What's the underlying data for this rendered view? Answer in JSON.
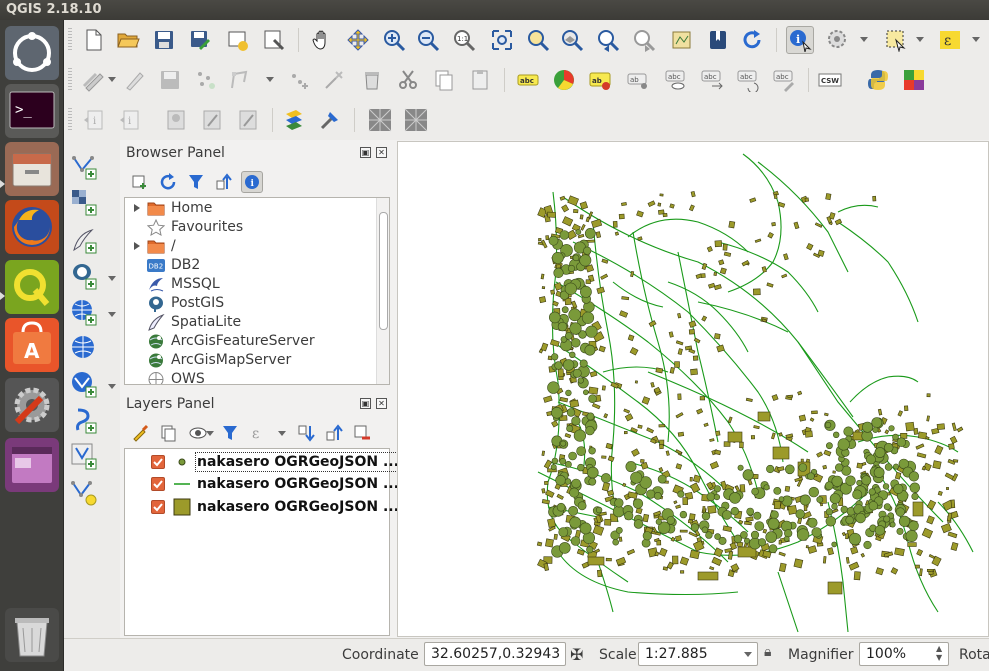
{
  "window": {
    "title": "QGIS 2.18.10"
  },
  "launcher": {
    "items": [
      "dash-home",
      "terminal",
      "files",
      "firefox",
      "qgis",
      "software-center",
      "system-settings",
      "workspace-switcher",
      "trash"
    ]
  },
  "browser_panel": {
    "title": "Browser Panel",
    "items": [
      {
        "label": "Home",
        "icon": "folder-icon",
        "expandable": true
      },
      {
        "label": "Favourites",
        "icon": "star-icon",
        "expandable": false
      },
      {
        "label": "/",
        "icon": "folder-icon",
        "expandable": true
      },
      {
        "label": "DB2",
        "icon": "db2-icon",
        "expandable": false
      },
      {
        "label": "MSSQL",
        "icon": "mssql-icon",
        "expandable": false
      },
      {
        "label": "PostGIS",
        "icon": "postgis-icon",
        "expandable": false
      },
      {
        "label": "SpatiaLite",
        "icon": "spatialite-icon",
        "expandable": false
      },
      {
        "label": "ArcGisFeatureServer",
        "icon": "arcgis-icon",
        "expandable": false
      },
      {
        "label": "ArcGisMapServer",
        "icon": "arcgis-icon",
        "expandable": false
      },
      {
        "label": "OWS",
        "icon": "globe-icon",
        "expandable": false
      }
    ]
  },
  "layers_panel": {
    "title": "Layers Panel",
    "layers": [
      {
        "name": "nakasero OGRGeoJSON ...",
        "geometry": "point",
        "checked": true
      },
      {
        "name": "nakasero OGRGeoJSON ...",
        "geometry": "line",
        "checked": true
      },
      {
        "name": "nakasero OGRGeoJSON ...",
        "geometry": "polygon",
        "checked": true
      }
    ]
  },
  "colors": {
    "line": "#1a9a1a",
    "polygon_fill": "#9c9a2a",
    "polygon_stroke": "#3c3a10",
    "point_fill": "#7a9a3a",
    "checkbox": "#e2653b"
  },
  "status": {
    "coordinate_label": "Coordinate",
    "coordinate_value": "32.60257,0.32943",
    "scale_label": "Scale",
    "scale_value": "1:27.885",
    "magnifier_label": "Magnifier",
    "magnifier_value": "100%",
    "rotation_label": "Rota"
  }
}
